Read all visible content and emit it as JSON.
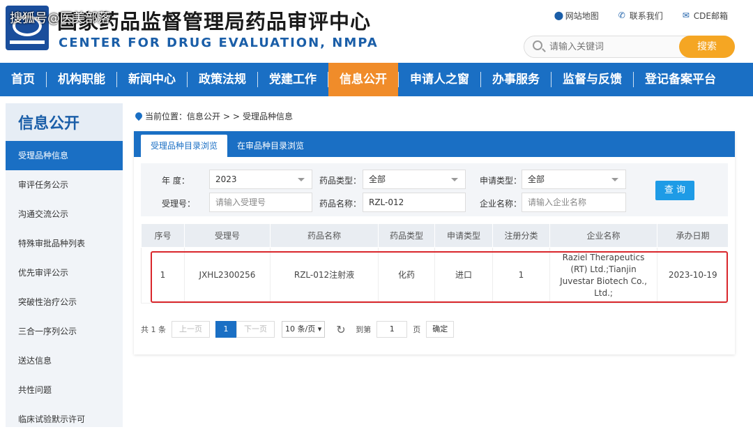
{
  "watermark": "搜狐号@医美部落",
  "header": {
    "title_cn": "国家药品监督管理局药品审评中心",
    "title_en": "CENTER FOR DRUG EVALUATION, NMPA",
    "links": [
      "网站地图",
      "联系我们",
      "CDE邮箱"
    ],
    "search_placeholder": "请输入关键词",
    "search_button": "搜索"
  },
  "nav": [
    "首页",
    "机构职能",
    "新闻中心",
    "政策法规",
    "党建工作",
    "信息公开",
    "申请人之窗",
    "办事服务",
    "监督与反馈",
    "登记备案平台"
  ],
  "sidebar": {
    "title": "信息公开",
    "items": [
      "受理品种信息",
      "审评任务公示",
      "沟通交流公示",
      "特殊审批品种列表",
      "优先审评公示",
      "突破性治疗公示",
      "三合一序列公示",
      "送达信息",
      "共性问题",
      "临床试验默示许可"
    ]
  },
  "breadcrumb": {
    "prefix": "当前位置：信息公开",
    "sep": "> >",
    "current": "受理品种信息"
  },
  "tabs": [
    "受理品种目录浏览",
    "在审品种目录浏览"
  ],
  "filter": {
    "year_label": "年    度：",
    "year_value": "2023",
    "drug_type_label": "药品类型：",
    "drug_type_value": "全部",
    "apply_type_label": "申请类型：",
    "apply_type_value": "全部",
    "accept_no_label": "受理号：",
    "accept_no_placeholder": "请输入受理号",
    "drug_name_label": "药品名称：",
    "drug_name_value": "RZL-012",
    "company_label": "企业名称：",
    "company_placeholder": "请输入企业名称",
    "query_button": "查 询"
  },
  "table": {
    "headers": [
      "序号",
      "受理号",
      "药品名称",
      "药品类型",
      "申请类型",
      "注册分类",
      "企业名称",
      "承办日期"
    ],
    "rows": [
      [
        "1",
        "JXHL2300256",
        "RZL-012注射液",
        "化药",
        "进口",
        "1",
        "Raziel Therapeutics (RT) Ltd.;Tianjin Juvestar Biotech Co., Ltd.;",
        "2023-10-19"
      ]
    ]
  },
  "pager": {
    "total": "共 1 条",
    "prev": "上一页",
    "page": "1",
    "next": "下一页",
    "per_page": "10 条/页",
    "goto_label": "到第",
    "goto_value": "1",
    "page_unit": "页",
    "confirm": "确定"
  },
  "colors": {
    "nav_blue": "#1a6fc4",
    "active_orange": "#f08c2a",
    "search_button": "#f5a623",
    "highlight_red": "#d9262b"
  }
}
